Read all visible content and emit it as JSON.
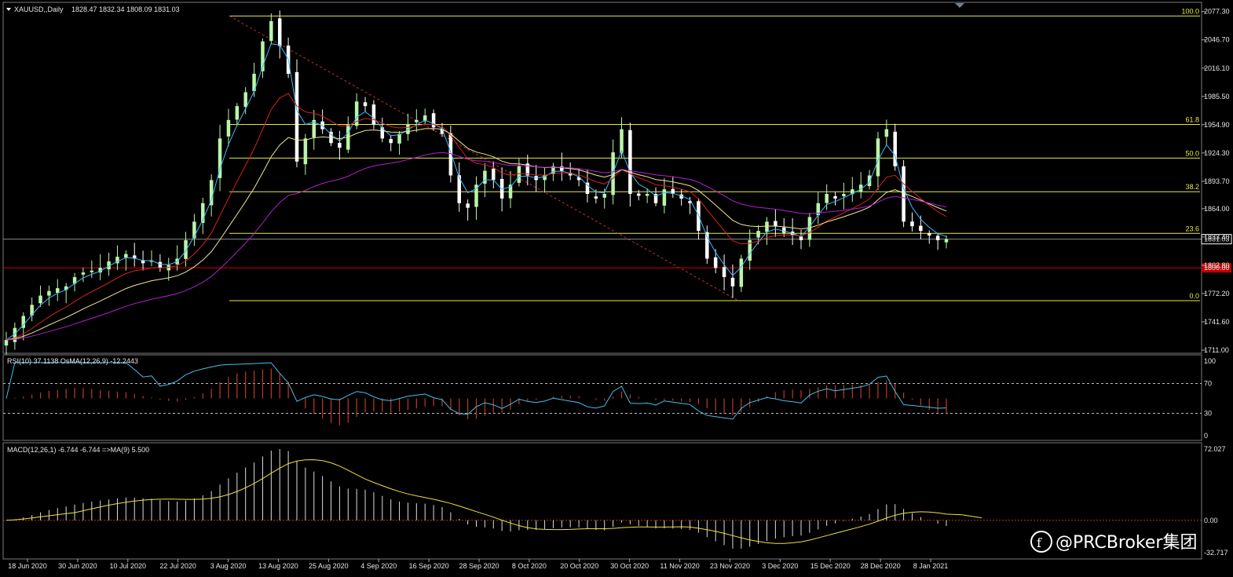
{
  "header": {
    "symbol": "XAUUSD,,Daily",
    "ohlc": "1828.47 1832.34 1808.09 1831.03"
  },
  "rsi_header": "RSI(10) 37.1138  OsMA(12,26,9) -12.2443",
  "macd_header": "MACD(12,26,1) -6.744 -6.744  =>MA(9) 5.500",
  "watermark": "@PRCBroker集团",
  "colors": {
    "background": "#000000",
    "bull_candle": "#b9f5a9",
    "bear_candle": "#ffffff",
    "ma_fast": "#3fb8ff",
    "ma_mid": "#d42020",
    "ma_slow": "#f0e68c",
    "ma_long": "#b020d0",
    "fib_line": "#e8e84a",
    "rsi_line": "#45c0e8",
    "osma_bars": "#c0392b",
    "macd_bars": "#dcdcdc",
    "macd_signal": "#f0e040",
    "level_1800": "#c00000",
    "current_price_box": "#ffffff"
  },
  "chart_data": [
    {
      "type": "candlestick",
      "panel": "price",
      "y_ticks": [
        "2077.30",
        "2046.70",
        "2016.10",
        "1985.50",
        "1954.90",
        "1924.30",
        "1893.70",
        "1864.00",
        "1833.40",
        "1802.80",
        "1772.20",
        "1741.60",
        "1711.00"
      ],
      "ylim": [
        1711.0,
        2083.0
      ],
      "x_dates": [
        "18 Jun 2020",
        "30 Jun 2020",
        "10 Jul 2020",
        "22 Jul 2020",
        "3 Aug 2020",
        "13 Aug 2020",
        "25 Aug 2020",
        "4 Sep 2020",
        "16 Sep 2020",
        "28 Sep 2020",
        "8 Oct 2020",
        "20 Oct 2020",
        "30 Oct 2020",
        "11 Nov 2020",
        "23 Nov 2020",
        "3 Dec 2020",
        "15 Dec 2020",
        "28 Dec 2020",
        "8 Jan 2021"
      ],
      "current_price": "1831.03",
      "level_1800": "1800.00",
      "fibonacci": {
        "levels": [
          {
            "label": "100.0",
            "price": 2072.5
          },
          {
            "label": "61.8",
            "price": 1955.2
          },
          {
            "label": "50.0",
            "price": 1918.8
          },
          {
            "label": "38.2",
            "price": 1882.4
          },
          {
            "label": "23.6",
            "price": 1837.3
          },
          {
            "label": "0.0",
            "price": 1764.5
          }
        ]
      },
      "closes": [
        1722,
        1735,
        1748,
        1760,
        1770,
        1775,
        1778,
        1780,
        1790,
        1795,
        1797,
        1800,
        1807,
        1812,
        1815,
        1810,
        1805,
        1808,
        1800,
        1803,
        1810,
        1830,
        1850,
        1870,
        1895,
        1940,
        1960,
        1975,
        1990,
        2010,
        2045,
        2067,
        2040,
        2010,
        1915,
        1940,
        1960,
        1950,
        1935,
        1930,
        1955,
        1980,
        1975,
        1955,
        1940,
        1935,
        1945,
        1955,
        1960,
        1965,
        1952,
        1945,
        1900,
        1870,
        1865,
        1890,
        1905,
        1895,
        1875,
        1890,
        1910,
        1900,
        1895,
        1900,
        1910,
        1905,
        1900,
        1895,
        1880,
        1875,
        1880,
        1925,
        1950,
        1880,
        1878,
        1880,
        1870,
        1885,
        1880,
        1875,
        1870,
        1840,
        1810,
        1800,
        1790,
        1780,
        1810,
        1830,
        1840,
        1850,
        1845,
        1838,
        1835,
        1830,
        1855,
        1870,
        1880,
        1875,
        1880,
        1885,
        1890,
        1900,
        1940,
        1950,
        1910,
        1850,
        1845,
        1840,
        1835,
        1830,
        1831
      ],
      "moving_averages": [
        "fast",
        "mid",
        "slow",
        "long"
      ]
    },
    {
      "type": "line",
      "panel": "rsi",
      "name": "RSI(10)",
      "y_ticks": [
        "100",
        "70",
        "30",
        "0"
      ],
      "ylim": [
        0,
        100
      ],
      "levels": [
        70,
        30
      ],
      "value": 37.1138
    },
    {
      "type": "bar",
      "panel": "macd",
      "name": "MACD(12,26,1)",
      "y_ticks": [
        "72.027",
        "0.00",
        "-32.717"
      ],
      "ylim": [
        -32.717,
        72.027
      ],
      "macd_value": -6.744,
      "signal_value": 5.5
    }
  ]
}
